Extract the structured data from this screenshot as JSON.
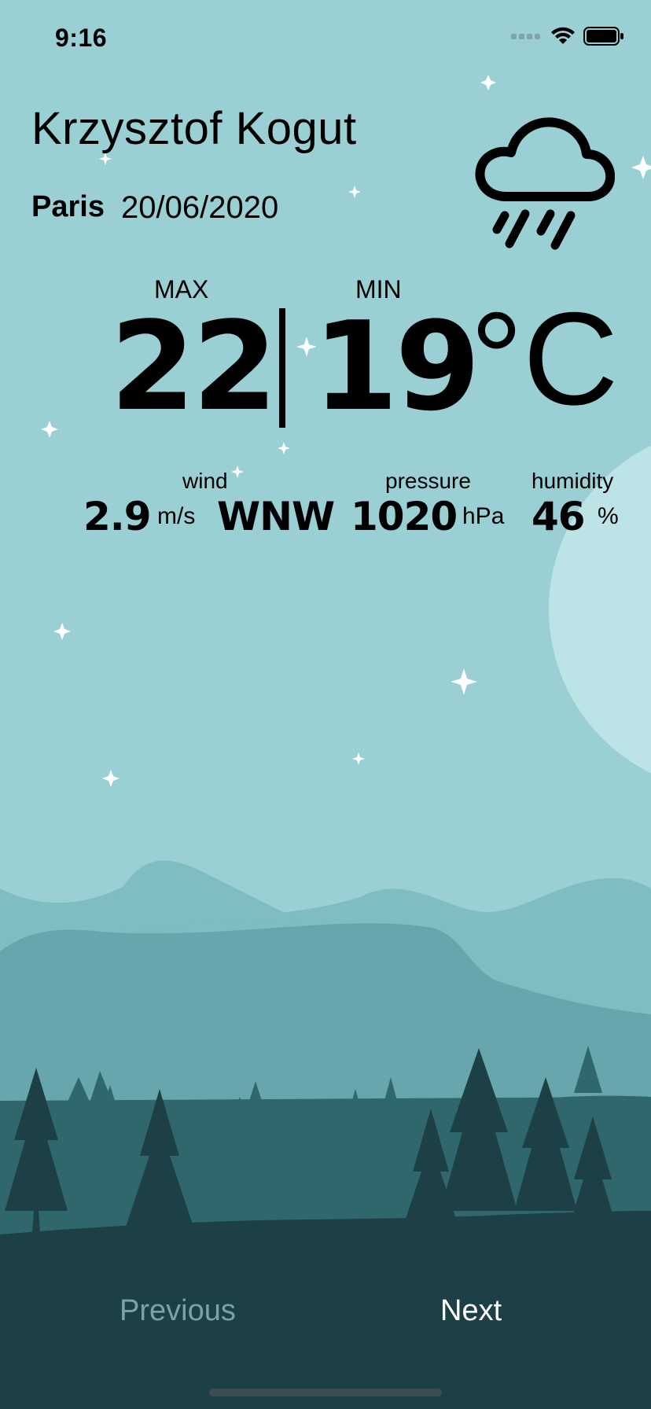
{
  "status_bar": {
    "time": "9:16",
    "icons": [
      "signal-icon",
      "wifi-icon",
      "battery-icon"
    ]
  },
  "header": {
    "name": "Krzysztof Kogut",
    "city": "Paris",
    "date": "20/06/2020"
  },
  "weather": {
    "icon": "cloud-rain-icon",
    "max_label": "MAX",
    "min_label": "MIN",
    "max": "22",
    "min": "19",
    "unit": "°C"
  },
  "details": {
    "wind_label": "wind",
    "wind_speed": "2.9",
    "wind_unit": "m/s",
    "wind_direction": "WNW",
    "pressure_label": "pressure",
    "pressure": "1020",
    "pressure_unit": "hPa",
    "humidity_label": "humidity",
    "humidity": "46",
    "humidity_unit": "%"
  },
  "nav": {
    "previous_label": "Previous",
    "next_label": "Next"
  },
  "colors": {
    "sky": "#9ACFD4",
    "moon": "#BCE3E6",
    "hills_far": "#7FBDC2",
    "hills_mid": "#66A6AC",
    "forest_back": "#30676D",
    "forest_front": "#1C4046",
    "previous_text": "#7BA3A6",
    "next_text": "#FFFFFF"
  }
}
